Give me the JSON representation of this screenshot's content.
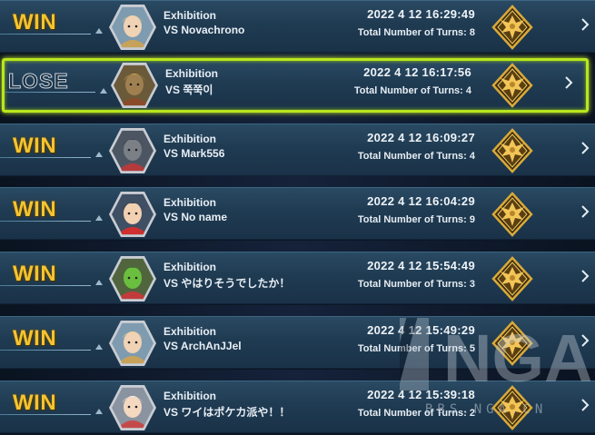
{
  "matches": [
    {
      "result": "WIN",
      "mode": "Exhibition",
      "opponent": "VS Novachrono",
      "datetime": "2022 4 12 16:29:49",
      "turns": "Total Number of Turns: 8",
      "rank_icon": "gold-rank-emblem",
      "avatar_icon": "duelist-avatar-blonde-hat"
    },
    {
      "result": "LOSE",
      "mode": "Exhibition",
      "opponent": "VS 쭉쭉이",
      "datetime": "2022 4 12 16:17:56",
      "turns": "Total Number of Turns: 4",
      "rank_icon": "gold-rank-emblem",
      "avatar_icon": "duelist-avatar-armored"
    },
    {
      "result": "WIN",
      "mode": "Exhibition",
      "opponent": "VS Mark556",
      "datetime": "2022 4 12 16:09:27",
      "turns": "Total Number of Turns: 4",
      "rank_icon": "gold-rank-emblem",
      "avatar_icon": "duelist-avatar-dragon"
    },
    {
      "result": "WIN",
      "mode": "Exhibition",
      "opponent": "VS No name",
      "datetime": "2022 4 12 16:04:29",
      "turns": "Total Number of Turns: 9",
      "rank_icon": "gold-rank-emblem",
      "avatar_icon": "duelist-avatar-red-cap"
    },
    {
      "result": "WIN",
      "mode": "Exhibition",
      "opponent": "VS やはりそうでしたか！",
      "datetime": "2022 4 12 15:54:49",
      "turns": "Total Number of Turns: 3",
      "rank_icon": "gold-rank-emblem",
      "avatar_icon": "duelist-avatar-green-frog"
    },
    {
      "result": "WIN",
      "mode": "Exhibition",
      "opponent": "VS ArchAnJJel",
      "datetime": "2022 4 12 15:49:29",
      "turns": "Total Number of Turns: 5",
      "rank_icon": "gold-rank-emblem",
      "avatar_icon": "duelist-avatar-blonde-hat"
    },
    {
      "result": "WIN",
      "mode": "Exhibition",
      "opponent": "VS ワイはポケカ派や！！",
      "datetime": "2022 4 12 15:39:18",
      "turns": "Total Number of Turns: 2",
      "rank_icon": "gold-rank-emblem",
      "avatar_icon": "duelist-avatar-white-hair"
    }
  ],
  "selected_index": 1,
  "watermark": {
    "logo": "NGA",
    "site": "BBS.NGA.CN"
  },
  "colors": {
    "win": "#f4c430",
    "lose_outline": "#c8d4de",
    "selected_border": "#b9e61e",
    "row_bg": "#1f3b52"
  }
}
